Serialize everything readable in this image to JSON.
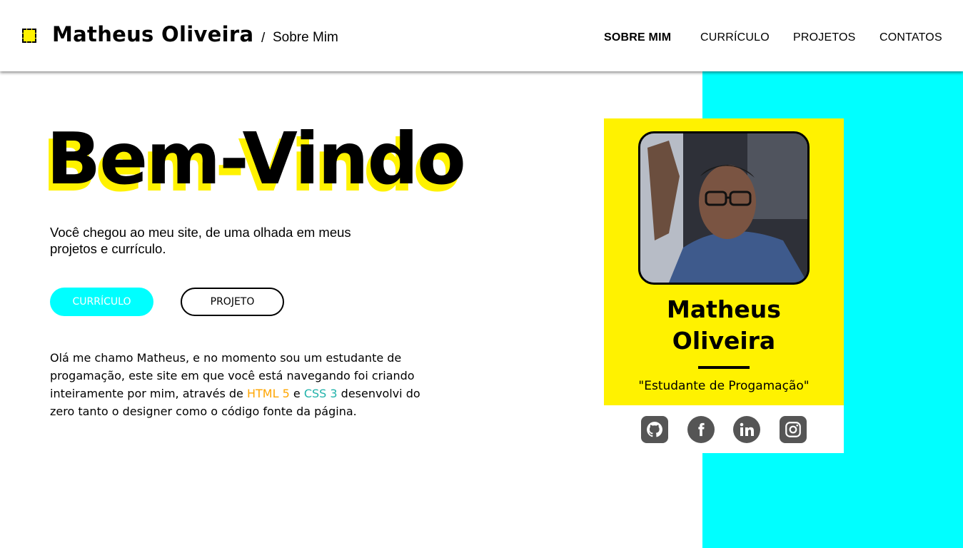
{
  "header": {
    "brand": "Matheus Oliveira",
    "breadcrumb_sep": "/",
    "breadcrumb": "Sobre Mim",
    "nav": [
      {
        "label": "SOBRE MIM",
        "active": true
      },
      {
        "label": "CURRÍCULO",
        "active": false
      },
      {
        "label": "PROJETOS",
        "active": false
      },
      {
        "label": "CONTATOS",
        "active": false
      }
    ]
  },
  "hero": {
    "title": "Bem-Vindo",
    "intro": "Você chegou ao meu site, de uma olhada em meus projetos e currículo.",
    "buttons": {
      "curriculo": "CURRÍCULO",
      "projeto": "PROJETO"
    }
  },
  "about": {
    "text_before": "Olá me chamo Matheus, e no momento sou um estudante de progamação, este site em que você está navegando foi criando inteiramente por mim, através de",
    "html_label": "HTML 5",
    "connector": "e",
    "css_label": "CSS 3",
    "text_after": "desenvolvi do zero tanto o designer como o código fonte da página."
  },
  "profile": {
    "first_name": "Matheus",
    "last_name": "Oliveira",
    "role": "\"Estudante de Progamação\"",
    "social_icons": [
      "github-icon",
      "facebook-icon",
      "linkedin-icon",
      "instagram-icon"
    ]
  },
  "colors": {
    "accent_yellow": "#fff200",
    "accent_cyan": "#00ffff",
    "html_orange": "#ffa500",
    "css_teal": "#20b2aa",
    "icon_gray": "#555555"
  }
}
